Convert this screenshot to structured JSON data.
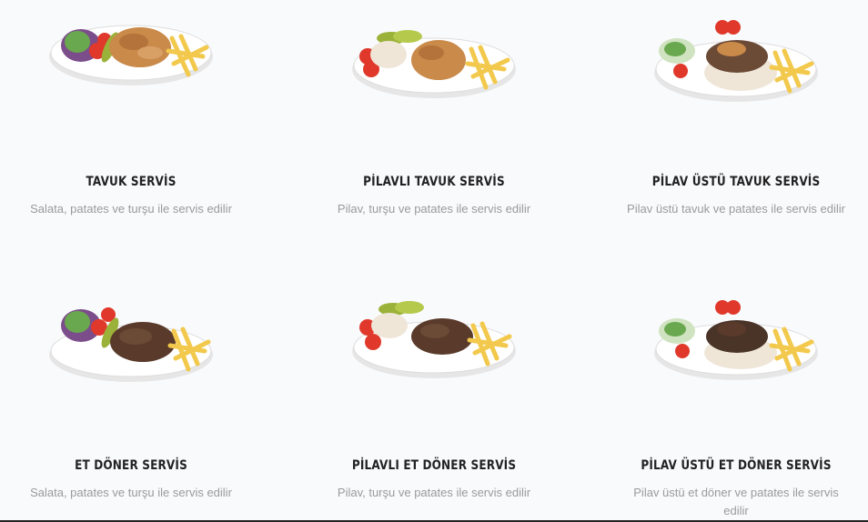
{
  "products": [
    {
      "title": "TAVUK SERVİS",
      "description": "Salata, patates ve turşu ile servis edilir"
    },
    {
      "title": "PİLAVLI TAVUK SERVİS",
      "description": "Pilav, turşu ve patates ile servis edilir"
    },
    {
      "title": "PİLAV ÜSTÜ TAVUK SERVİS",
      "description": "Pilav üstü tavuk ve patates ile servis edilir"
    },
    {
      "title": "ET DÖNER SERVİS",
      "description": "Salata, patates ve turşu ile servis edilir"
    },
    {
      "title": "PİLAVLI ET DÖNER SERVİS",
      "description": "Pilav, turşu ve patates ile servis edilir"
    },
    {
      "title": "PİLAV ÜSTÜ ET DÖNER SERVİS",
      "description": "Pilav üstü et döner ve patates ile servis edilir"
    }
  ],
  "colors": {
    "background": "#f9fafc",
    "title": "#222222",
    "description": "#9a9a9a",
    "chicken": "#c98a4a",
    "beef": "#5a3a2a",
    "fries": "#f2c94c",
    "tomato": "#e0392b",
    "pickle": "#9bb23a",
    "rice": "#efe6d8",
    "lettuce": "#6aa84f"
  }
}
